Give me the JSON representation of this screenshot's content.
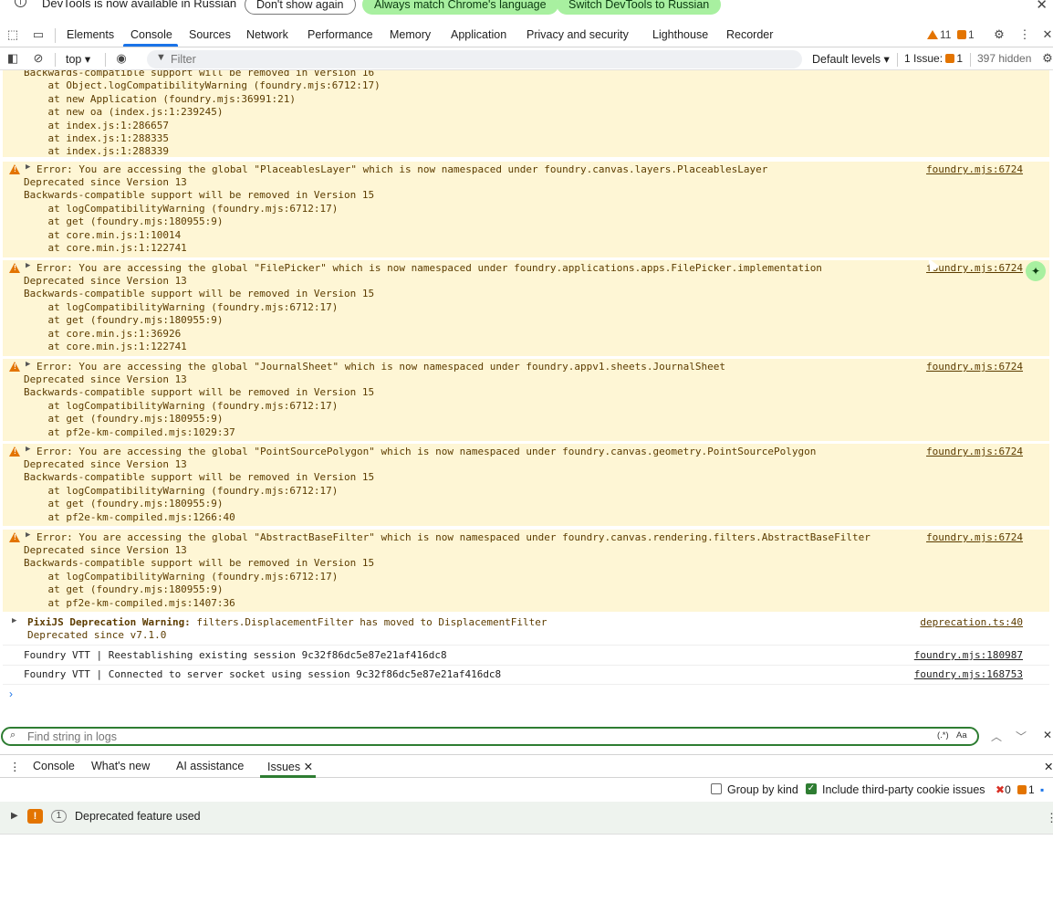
{
  "infobar": {
    "message": "DevTools is now available in Russian",
    "dont_show": "Don't show again",
    "always_match": "Always match Chrome's language",
    "switch": "Switch DevTools to Russian"
  },
  "tabs": [
    "Elements",
    "Console",
    "Sources",
    "Network",
    "Performance",
    "Memory",
    "Application",
    "Privacy and security",
    "Lighthouse",
    "Recorder"
  ],
  "tab_badges": {
    "warnings": "11",
    "issues": "1"
  },
  "console_toolbar": {
    "context": "top",
    "filter_placeholder": "Filter",
    "levels": "Default levels",
    "issues_label": "1 Issue:",
    "issues_count": "1",
    "hidden": "397 hidden"
  },
  "top_partial": {
    "lines": [
      "Backwards-compatible support will be removed in Version 16",
      "    at Object.logCompatibilityWarning (foundry.mjs:6712:17)",
      "    at new Application (foundry.mjs:36991:21)",
      "    at new oa (index.js:1:239245)",
      "    at index.js:1:286657",
      "    at index.js:1:288335",
      "    at index.js:1:288339"
    ]
  },
  "warnings": [
    {
      "message": "Error: You are accessing the global \"PlaceablesLayer\" which is now namespaced under foundry.canvas.layers.PlaceablesLayer",
      "source": "foundry.mjs:6724",
      "lines": [
        "Deprecated since Version 13",
        "Backwards-compatible support will be removed in Version 15",
        "    at logCompatibilityWarning (foundry.mjs:6712:17)",
        "    at get (foundry.mjs:180955:9)",
        "    at core.min.js:1:10014",
        "    at core.min.js:1:122741"
      ]
    },
    {
      "message": "Error: You are accessing the global \"FilePicker\" which is now namespaced under foundry.applications.apps.FilePicker.implementation",
      "source": "foundry.mjs:6724",
      "lines": [
        "Deprecated since Version 13",
        "Backwards-compatible support will be removed in Version 15",
        "    at logCompatibilityWarning (foundry.mjs:6712:17)",
        "    at get (foundry.mjs:180955:9)",
        "    at core.min.js:1:36926",
        "    at core.min.js:1:122741"
      ]
    },
    {
      "message": "Error: You are accessing the global \"JournalSheet\" which is now namespaced under foundry.appv1.sheets.JournalSheet",
      "source": "foundry.mjs:6724",
      "lines": [
        "Deprecated since Version 13",
        "Backwards-compatible support will be removed in Version 15",
        "    at logCompatibilityWarning (foundry.mjs:6712:17)",
        "    at get (foundry.mjs:180955:9)",
        "    at pf2e-km-compiled.mjs:1029:37"
      ]
    },
    {
      "message": "Error: You are accessing the global \"PointSourcePolygon\" which is now namespaced under foundry.canvas.geometry.PointSourcePolygon",
      "source": "foundry.mjs:6724",
      "lines": [
        "Deprecated since Version 13",
        "Backwards-compatible support will be removed in Version 15",
        "    at logCompatibilityWarning (foundry.mjs:6712:17)",
        "    at get (foundry.mjs:180955:9)",
        "    at pf2e-km-compiled.mjs:1266:40"
      ]
    },
    {
      "message": "Error: You are accessing the global \"AbstractBaseFilter\" which is now namespaced under foundry.canvas.rendering.filters.AbstractBaseFilter",
      "source": "foundry.mjs:6724",
      "lines": [
        "Deprecated since Version 13",
        "Backwards-compatible support will be removed in Version 15",
        "    at logCompatibilityWarning (foundry.mjs:6712:17)",
        "    at get (foundry.mjs:180955:9)",
        "    at pf2e-km-compiled.mjs:1407:36"
      ]
    }
  ],
  "pixi": {
    "label": "PixiJS Deprecation Warning:",
    "message": " filters.DisplacementFilter has moved to DisplacementFilter",
    "sub": "Deprecated since v7.1.0",
    "source": "deprecation.ts:40"
  },
  "info_logs": [
    {
      "message": "Foundry VTT | Reestablishing existing session 9c32f86dc5e87e21af416dc8",
      "source": "foundry.mjs:180987"
    },
    {
      "message": "Foundry VTT | Connected to server socket using session 9c32f86dc5e87e21af416dc8",
      "source": "foundry.mjs:168753"
    }
  ],
  "findbar": {
    "placeholder": "Find string in logs",
    "regex": "(.*)",
    "case": "Aa"
  },
  "drawer_tabs": [
    "Console",
    "What's new",
    "AI assistance",
    "Issues"
  ],
  "issues_panel": {
    "group_by_kind": "Group by kind",
    "include_third_party": "Include third-party cookie issues",
    "errors": "0",
    "warnings": "1",
    "issue_title": "Deprecated feature used",
    "issue_count": "1"
  }
}
